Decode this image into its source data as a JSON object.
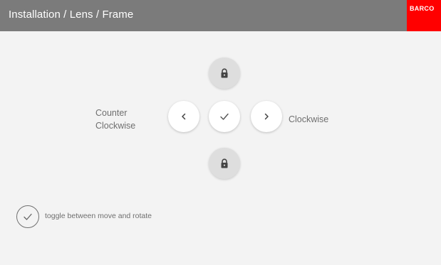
{
  "header": {
    "title": "Installation / Lens / Frame",
    "logo_text": "BARCO"
  },
  "controls": {
    "label_counter_line1": "Counter",
    "label_counter_line2": "Clockwise",
    "label_clockwise": "Clockwise",
    "up_icon": "lock-icon",
    "down_icon": "lock-icon",
    "left_icon": "chevron-left-icon",
    "center_icon": "check-icon",
    "right_icon": "chevron-right-icon"
  },
  "legend": {
    "icon": "check-icon",
    "text": "toggle between move and rotate"
  },
  "colors": {
    "header_bg": "#7b7b7b",
    "logo_bg": "#ff0000",
    "content_bg": "#f3f3f3",
    "text_grey": "#6f6f6f"
  }
}
